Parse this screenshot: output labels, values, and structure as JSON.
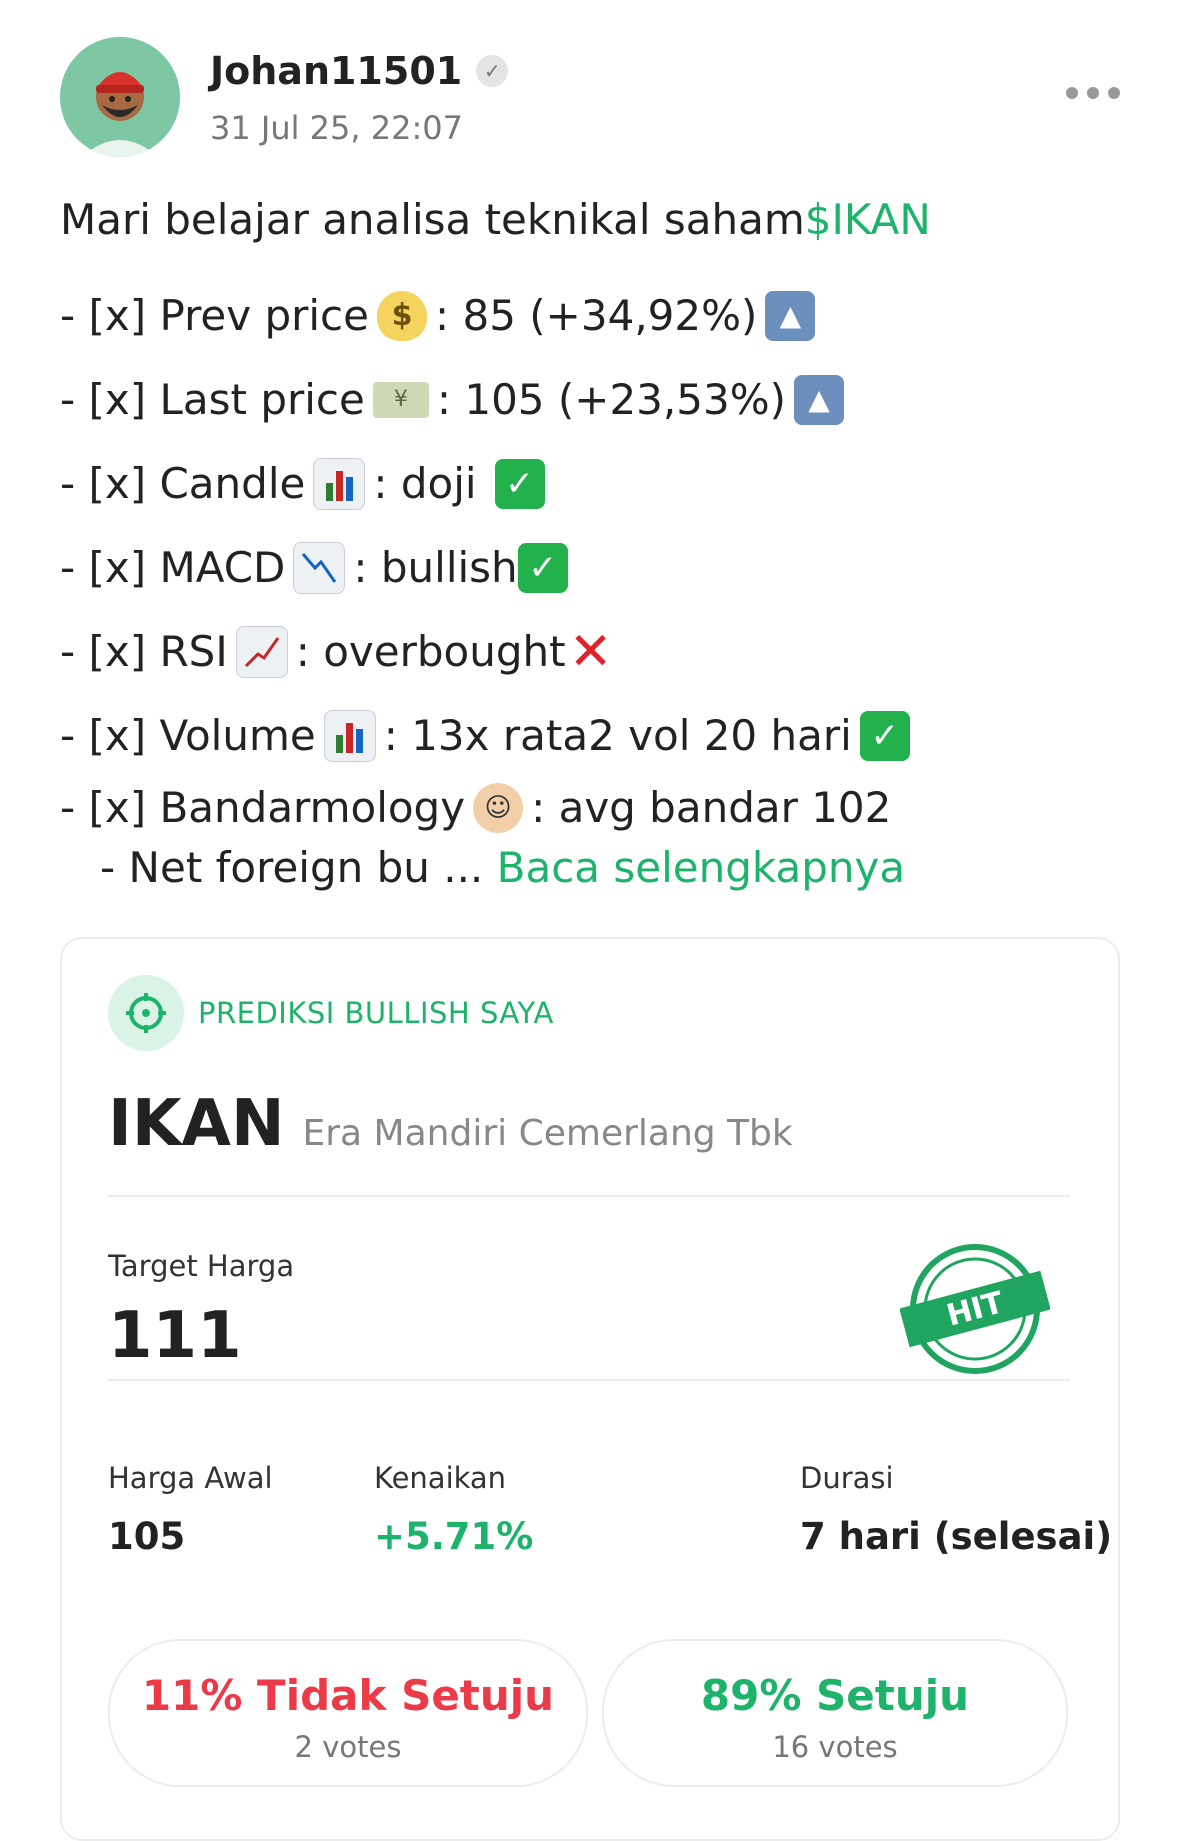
{
  "post": {
    "username": "Johan11501",
    "timestamp": "31 Jul 25, 22:07",
    "intro": "Mari belajar analisa teknikal saham ",
    "ticker": "$IKAN",
    "lines": [
      {
        "before": "- [x] Prev price ",
        "after": " :  85 (+34,92%)"
      },
      {
        "before": "- [x] Last price ",
        "after": ": 105 (+23,53%)"
      },
      {
        "before": "- [x] Candle ",
        "after": " : doji "
      },
      {
        "before": "- [x] MACD ",
        "after": " : bullish"
      },
      {
        "before": "- [x] RSI ",
        "after": ": overbought"
      },
      {
        "before": "- [x] Volume ",
        "after": " : 13x rata2 vol 20 hari "
      },
      {
        "before": "- [x] Bandarmology ",
        "after": " : avg bandar 102"
      }
    ],
    "truncated_line": "   - Net foreign bu ... ",
    "read_more": "Baca selengkapnya",
    "icons": [
      "verified-icon",
      "money-bag-icon",
      "up-arrow-icon",
      "banknote-icon",
      "bar-chart-icon",
      "check-icon",
      "chart-decreasing-icon",
      "chart-increasing-icon",
      "cross-mark-icon",
      "person-in-tuxedo-icon",
      "more-options-icon"
    ]
  },
  "prediction": {
    "header": "PREDIKSI BULLISH SAYA",
    "code": "IKAN",
    "company": "Era Mandiri Cemerlang Tbk",
    "target_label": "Target Harga",
    "target_value": "111",
    "stamp_text": "HIT",
    "start_label": "Harga Awal",
    "start_value": "105",
    "change_label": "Kenaikan",
    "change_value": "+5.71%",
    "duration_label": "Durasi",
    "duration_value": "7 hari (selesai)",
    "disagree_label": "11% Tidak Setuju",
    "disagree_votes": "2 votes",
    "agree_label": "89% Setuju",
    "agree_votes": "16 votes"
  },
  "colors": {
    "accent_green": "#1db36b",
    "negative_red": "#ec3b48",
    "avatar_bg": "#7dc7a5"
  }
}
